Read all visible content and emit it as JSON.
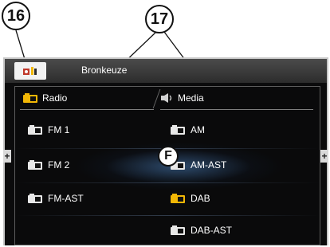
{
  "callouts": {
    "left": "16",
    "right": "17",
    "center": "F"
  },
  "topbar": {
    "title": "Bronkeuze"
  },
  "tabs": [
    {
      "label": "Radio",
      "icon": "radio-source-icon"
    },
    {
      "label": "Media",
      "icon": "media-source-icon"
    }
  ],
  "left_sources": [
    {
      "label": "FM 1",
      "icon": "radio-source-icon"
    },
    {
      "label": "FM 2",
      "icon": "radio-source-icon"
    },
    {
      "label": "FM-AST",
      "icon": "radio-source-icon"
    }
  ],
  "right_sources": [
    {
      "label": "AM",
      "icon": "radio-source-icon"
    },
    {
      "label": "AM-AST",
      "icon": "radio-source-icon"
    },
    {
      "label": "DAB",
      "icon": "radio-source-icon"
    },
    {
      "label": "DAB-AST",
      "icon": "radio-source-icon"
    }
  ],
  "side_buttons": {
    "left": "+",
    "right": "+"
  },
  "colors": {
    "accent_yellow": "#f2b705",
    "icon_white": "#e8e8e8",
    "highlight_blue": "#4a80be"
  }
}
